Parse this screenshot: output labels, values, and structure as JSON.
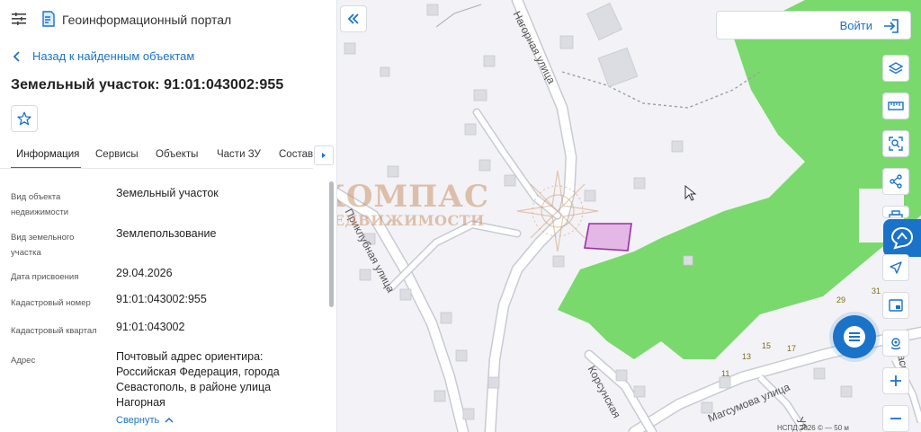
{
  "app": {
    "title": "Геоинформационный портал"
  },
  "nav": {
    "back_label": "Назад к найденным объектам"
  },
  "object": {
    "title": "Земельный участок: 91:01:043002:955"
  },
  "tabs": [
    {
      "label": "Информация",
      "active": true
    },
    {
      "label": "Сервисы"
    },
    {
      "label": "Объекты"
    },
    {
      "label": "Части ЗУ"
    },
    {
      "label": "Состав"
    }
  ],
  "info": {
    "rows": [
      {
        "label": "Вид объекта недвижимости",
        "value": "Земельный участок"
      },
      {
        "label": "Вид земельного участка",
        "value": "Землепользование"
      },
      {
        "label": "Дата присвоения",
        "value": "29.04.2026"
      },
      {
        "label": "Кадастровый номер",
        "value": "91:01:043002:955"
      },
      {
        "label": "Кадастровый квартал",
        "value": "91:01:043002"
      },
      {
        "label": "Адрес",
        "value": "Почтовый адрес ориентира: Российская Федерация, города Севастополь, в районе улица Нагорная"
      }
    ],
    "collapse_label": "Свернуть"
  },
  "map": {
    "login_label": "Войти",
    "streets": {
      "nagornaya": "Нагорная улица",
      "priklubnaya": "Приклубная улица",
      "korsunskaya": "Корсунская",
      "magsumova": "Магсумова улица",
      "edge1": "Ул",
      "edge2": "расн"
    },
    "house_numbers": [
      "29",
      "31",
      "15",
      "17",
      "13",
      "11"
    ],
    "attribution": "НСПД 2026 © — 50 м",
    "watermark_line1": "КОМПАС",
    "watermark_line2": "НЕДВИЖИМОСТИ"
  },
  "colors": {
    "accent": "#1a73c9",
    "forest": "#79d96d",
    "parcel_fill": "#e3b8e6",
    "parcel_stroke": "#9b2fa3"
  }
}
